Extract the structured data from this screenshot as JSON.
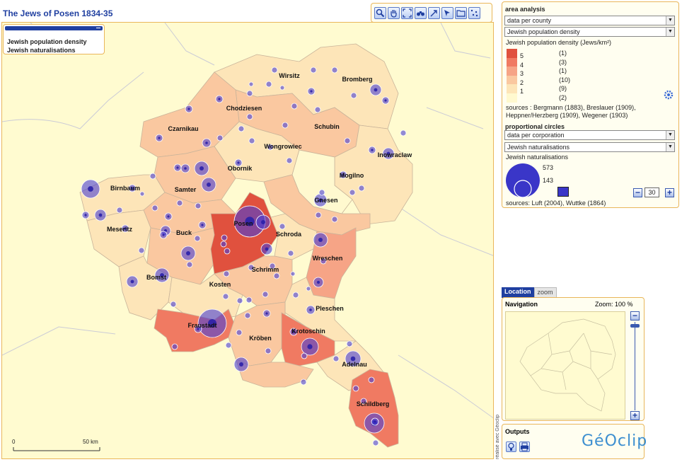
{
  "title": "The Jews of Posen 1834-35",
  "toolbar": {
    "tools": [
      "magnifier-icon",
      "hand-icon",
      "fullscreen-icon",
      "binoculars-icon",
      "pointer-icon",
      "select-icon",
      "folder-icon",
      "dots-icon"
    ]
  },
  "layers_legend": {
    "line1": "Jewish population density",
    "line2": "Jewish naturalisations"
  },
  "area_analysis": {
    "section": "area analysis",
    "level_select": "data per county",
    "variable_select": "Jewish population density",
    "caption": "Jewish population density (Jews/km²)",
    "classes": [
      {
        "label": "5",
        "count": "(1)",
        "color": "#e0513e"
      },
      {
        "label": "4",
        "count": "(3)",
        "color": "#f07a62"
      },
      {
        "label": "3",
        "count": "(1)",
        "color": "#f6a486"
      },
      {
        "label": "2",
        "count": "(10)",
        "color": "#fac8a0"
      },
      {
        "label": "1",
        "count": "(9)",
        "color": "#fde5b8"
      },
      {
        "label": "",
        "count": "(2)",
        "color": "#fff9cf"
      }
    ],
    "sources_1": "sources : Bergmann (1883), Breslauer (1909),",
    "sources_2": "Heppner/Herzberg (1909), Wegener (1903)"
  },
  "proportional": {
    "section": "proportional circles",
    "level_select": "data per corporation",
    "variable_select": "Jewish naturalisations",
    "caption": "Jewish naturalisations",
    "max_value": "573",
    "ref_value": "143",
    "size_value": "30",
    "sources": "sources: Luft (2004), Wuttke (1864)",
    "circle_color": "#3a36c8"
  },
  "location": {
    "tab_location": "Location",
    "tab_zoom": "zoom",
    "nav_title": "Navigation",
    "zoom_text": "Zoom: 100 %"
  },
  "outputs": {
    "title": "Outputs",
    "logo": "GéOclip"
  },
  "credit": "réalisé avec Géoclip",
  "scale": {
    "zero": "0",
    "fifty": "50 km"
  },
  "map_labels": [
    "Wirsitz",
    "Bromberg",
    "Chodziesen",
    "Czarnikau",
    "Schubin",
    "Wongrowiec",
    "Inowraclaw",
    "Obornik",
    "Mogilno",
    "Birnbaum",
    "Samter",
    "Gnesen",
    "Meseritz",
    "Posen",
    "Schroda",
    "Buck",
    "Wreschen",
    "Bomst",
    "Schrimm",
    "Kosten",
    "Pleschen",
    "Fraustadt",
    "Krotoschin",
    "Kröben",
    "Adelnau",
    "Schildberg"
  ]
}
